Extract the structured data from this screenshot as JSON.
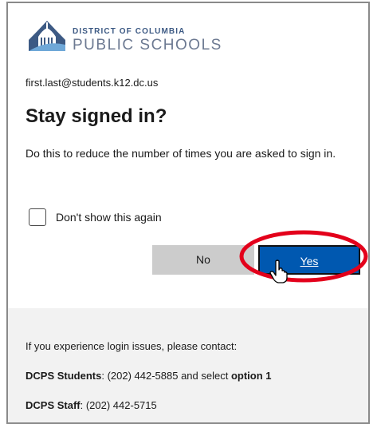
{
  "branding": {
    "line1": "DISTRICT OF COLUMBIA",
    "line2": "PUBLIC SCHOOLS"
  },
  "account": {
    "email": "first.last@students.k12.dc.us"
  },
  "prompt": {
    "title": "Stay signed in?",
    "description": "Do this to reduce the number of times you are asked to sign in.",
    "checkbox_label": "Don't show this again",
    "checkbox_checked": false
  },
  "buttons": {
    "no_label": "No",
    "yes_label": "Yes"
  },
  "annotation": {
    "color": "#e3001b"
  },
  "footer": {
    "intro": "If you experience login issues, please contact:",
    "students_label": "DCPS Students",
    "students_text": ": (202) 442-5885 and select ",
    "students_option": "option 1",
    "staff_label": "DCPS Staff",
    "staff_text": ": (202) 442-5715"
  },
  "colors": {
    "primary_button": "#0058b0",
    "secondary_button": "#cccccc",
    "footer_bg": "#f2f2f2",
    "brand_blue": "#3d5a84"
  }
}
